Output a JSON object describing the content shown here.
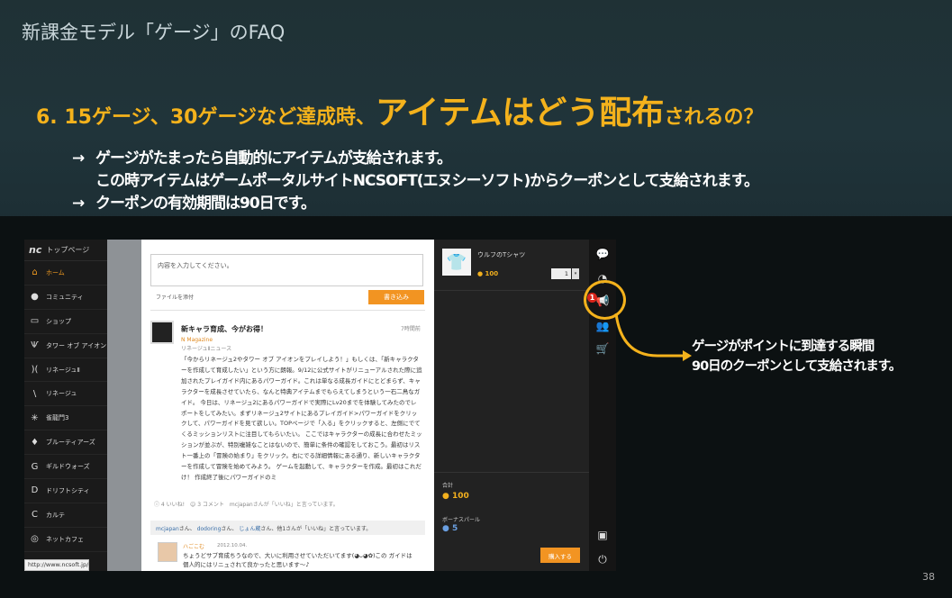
{
  "slide": {
    "title": "新課金モデル「ゲージ」のFAQ",
    "headline": {
      "part1": "6. 15ゲージ、30ゲージなど達成時、",
      "part2": "アイテムはどう配布",
      "part3": "されるの？"
    },
    "bullets": [
      {
        "arrow": "→",
        "line1": "ゲージがたまったら自動的にアイテムが支給されます。",
        "line2": "この時アイテムはゲームポータルサイトNCSOFT(エヌシーソフト)からクーポンとして支給されます。"
      },
      {
        "arrow": "→",
        "line1": "クーポンの有効期間は90日です。"
      }
    ],
    "callout": {
      "line1": "ゲージがポイントに到達する瞬間",
      "line2": "90日のクーポンとして支給されます。"
    },
    "page_number": "38",
    "accent_color": "#f4b21c"
  },
  "portal": {
    "logo": "nc",
    "top_page": "トップページ",
    "nav_items": [
      {
        "icon": "home-icon",
        "label": "ホーム",
        "active": true
      },
      {
        "icon": "community-icon",
        "label": "コミュニティ"
      },
      {
        "icon": "shop-icon",
        "label": "ショップ"
      },
      {
        "icon": "tower-of-aion-icon",
        "label": "タワー オブ アイオン"
      },
      {
        "icon": "lineage2-icon",
        "label": "リネージュⅡ"
      },
      {
        "icon": "lineage-icon",
        "label": "リネージュ"
      },
      {
        "icon": "sujaemun3-icon",
        "label": "雀龍門3"
      },
      {
        "icon": "bluetiers-icon",
        "label": "ブルーティアーズ"
      },
      {
        "icon": "guildwars-icon",
        "label": "ギルドウォーズ"
      },
      {
        "icon": "drift-city-icon",
        "label": "ドリフトシティ"
      },
      {
        "icon": "karte-icon",
        "label": "カルテ"
      },
      {
        "icon": "netcafe-icon",
        "label": "ネットカフェ"
      }
    ],
    "composer": {
      "placeholder": "内容を入力してください。",
      "attach": "ファイルを添付",
      "write_button": "書き込み"
    },
    "post": {
      "title": "新キャラ育成、今がお得！",
      "time": "7時間前",
      "source": "N Magazine",
      "category": "リネージュⅡニュース",
      "body": "「今からリネージュ2やタワー オブ アイオンをプレイしよう！」もしくは、「新キャラクターを作成して育成したい」という方に朗報。9/12に公式サイトがリニューアルされた際に追加されたプレイガイド内にあるパワーガイド。これは単なる成長ガイドにとどまらず、キャラクターを成長させていたら、なんと特典アイテムまでもらえてしまうという一石二鳥なガイド。 今日は、リネージュ2にあるパワーガイドで実際にLv20までを体験してみたのでレポートをしてみたい。まずリネージュ2サイトにあるプレイガイド>パワーガイドをクリックして、パワーガイドを見て欲しい。TOPページで「入る」をクリックすると、左側にでてくるミッションリストに注目してもらいたい。 ここではキャラクターの成長に合わせたミッションが並ぶが、特別複雑なことはないので、簡単に条件の確認をしておこう。最初はリスト一番上の「冒険の始まり」をクリック。右にでる詳細情報にある通り、新しいキャラクターを作成して冒険を始めてみよう。 ゲームを起動して、キャラクターを作成。最初はこれだけ！ 作成終了後にパワーガイドのミ",
      "actions": "ⓘ 4 いいね!　☺ 3 コメント　mcjapanさんが「いいね」と言っています。",
      "likes": {
        "user1": "mcjapan",
        "user2": "dodoring",
        "user3": "じょん蔵",
        "rest": "さん、他1さんが「いいね」と言っています。"
      },
      "comment": {
        "name": "ハごこむ",
        "date": "2012.10.04.",
        "text": "ちょうどサブ育成ちうなので、大いに利用させていただいてます(◕ᴗ◕✿)この ガイドは個人的にはリニュされて良かったと思います〜♪"
      }
    },
    "cart": {
      "item_name": "ウルフのTシャツ",
      "item_price": "100",
      "quantity": "1",
      "total_label": "合計",
      "total_value": "100",
      "bonus_label": "ボーナスパール",
      "bonus_value": "5",
      "buy_button": "購入する"
    },
    "rail": {
      "badge": "1"
    },
    "url": "http://www.ncsoft.jp/"
  }
}
